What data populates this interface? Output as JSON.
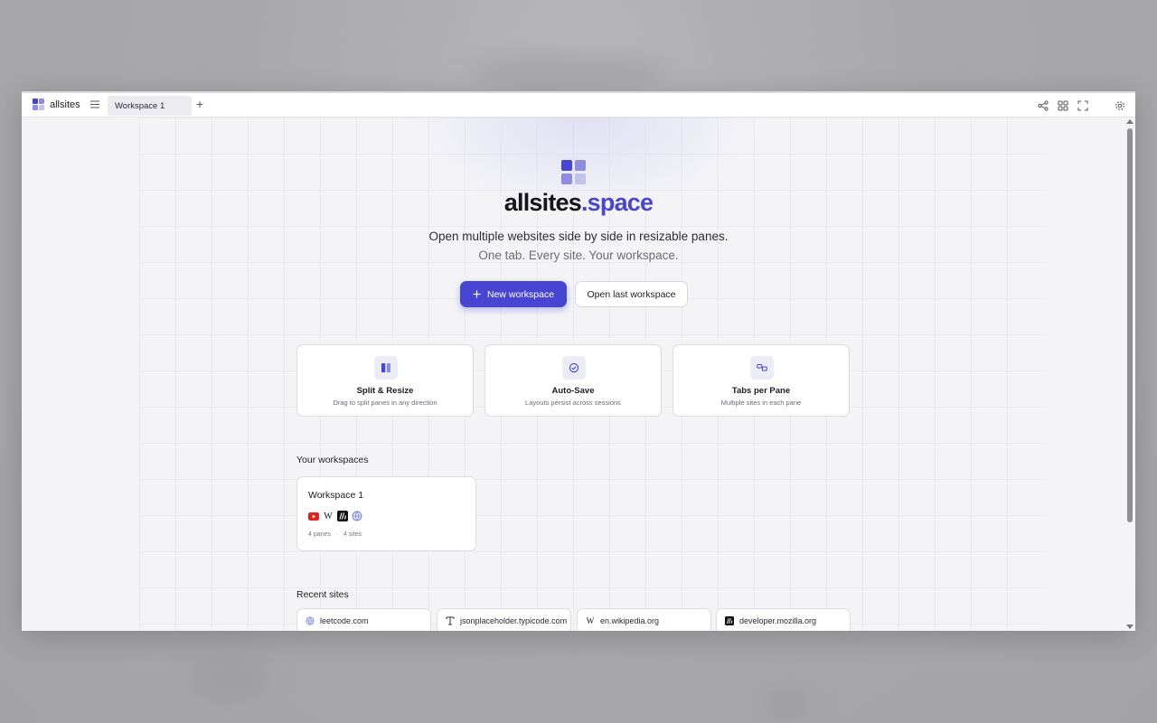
{
  "app": {
    "brand_name": "allsites",
    "colors": {
      "accent": "#4845d2",
      "accent_light": "#8f8de0",
      "accent_lighter": "#c3c2ee"
    }
  },
  "topbar": {
    "tabs": [
      {
        "label": "Workspace 1",
        "active": true
      }
    ],
    "add_tab_label": "+",
    "icons": [
      "share-icon",
      "grid-icon",
      "fullscreen-icon",
      "settings-icon"
    ]
  },
  "hero": {
    "title_main": "allsites",
    "title_accent": ".space",
    "tagline": "Open multiple websites side by side in resizable panes.",
    "subline": "One tab. Every site. Your workspace.",
    "primary_button": "New workspace",
    "secondary_button": "Open last workspace"
  },
  "features": [
    {
      "title": "Split & Resize",
      "desc": "Drag to split panes in any direction",
      "icon": "split-pane-icon"
    },
    {
      "title": "Auto-Save",
      "desc": "Layouts persist across sessions",
      "icon": "check-circle-icon"
    },
    {
      "title": "Tabs per Pane",
      "desc": "Multiple sites in each pane",
      "icon": "tabs-icon"
    }
  ],
  "workspaces": {
    "section_title": "Your workspaces",
    "items": [
      {
        "name": "Workspace 1",
        "site_icons": [
          "youtube-icon",
          "wikipedia-icon",
          "mdn-icon",
          "globe-icon"
        ],
        "panes": "4 panes",
        "separator": "·",
        "sites": "4 sites"
      }
    ]
  },
  "recent_sites": {
    "section_title": "Recent sites",
    "items": [
      {
        "label": "leetcode.com",
        "icon": "globe-icon"
      },
      {
        "label": "jsonplaceholder.typicode.com",
        "icon": "typicode-icon"
      },
      {
        "label": "en.wikipedia.org",
        "icon": "wikipedia-icon"
      },
      {
        "label": "developer.mozilla.org",
        "icon": "mdn-icon"
      }
    ]
  }
}
